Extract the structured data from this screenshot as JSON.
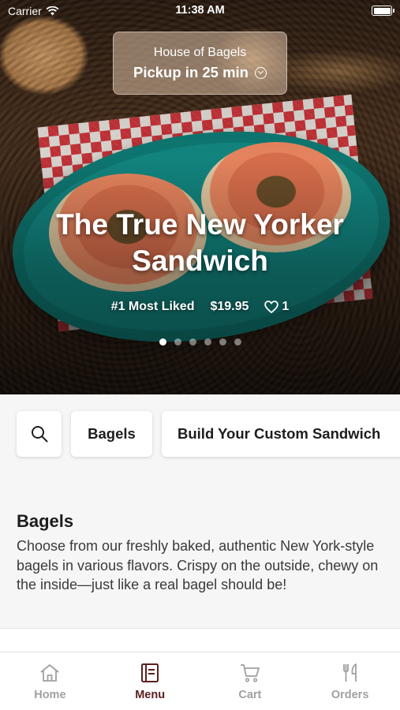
{
  "status_bar": {
    "carrier": "Carrier",
    "time": "11:38 AM"
  },
  "store": {
    "name": "House of Bagels",
    "pickup": "Pickup in 25 min"
  },
  "feature": {
    "title_line1": "The True New Yorker",
    "title_line2": "Sandwich",
    "badge": "#1 Most Liked",
    "price": "$19.95",
    "likes": "1",
    "slides": 6,
    "active_slide": 1
  },
  "categories": [
    {
      "label": "Bagels"
    },
    {
      "label": "Build Your Custom Sandwich"
    }
  ],
  "section": {
    "title": "Bagels",
    "description": "Choose from our freshly baked, authentic New York-style bagels in various flavors. Crispy on the outside, chewy on the inside—just like a real bagel should be!"
  },
  "tabs": [
    {
      "label": "Home",
      "icon": "home-icon",
      "active": false
    },
    {
      "label": "Menu",
      "icon": "menu-icon",
      "active": true
    },
    {
      "label": "Cart",
      "icon": "cart-icon",
      "active": false
    },
    {
      "label": "Orders",
      "icon": "orders-icon",
      "active": false
    }
  ],
  "colors": {
    "accent": "#5a1f1f",
    "inactive_tab": "#a0a0a0",
    "background": "#f6f6f6"
  }
}
